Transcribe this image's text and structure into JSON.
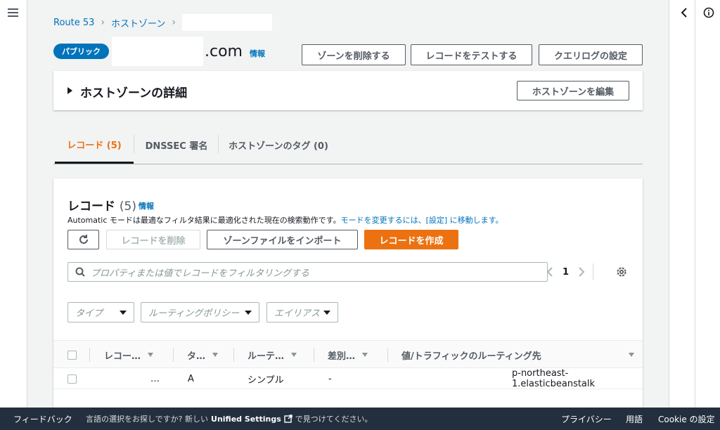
{
  "breadcrumb": {
    "root": "Route 53",
    "zones": "ホストゾーン"
  },
  "header": {
    "badge": "パブリック",
    "domain_suffix": ".com",
    "info": "情報",
    "delete_zone": "ゾーンを削除する",
    "test_record": "レコードをテストする",
    "query_log": "クエリログの設定"
  },
  "details": {
    "title": "ホストゾーンの詳細",
    "edit": "ホストゾーンを編集"
  },
  "tabs": [
    {
      "label": "レコード (5)"
    },
    {
      "label": "DNSSEC 署名"
    },
    {
      "label": "ホストゾーンのタグ (0)"
    }
  ],
  "records": {
    "title": "レコード",
    "count": "(5)",
    "info": "情報",
    "desc_prefix": "Automatic モードは最適なフィルタ結果に最適化された現在の検索動作です。",
    "desc_link": "モードを変更するには、[設定] に移動します。",
    "delete": "レコードを削除",
    "import": "ゾーンファイルをインポート",
    "create": "レコードを作成",
    "search_placeholder": "プロパティまたは値でレコードをフィルタリングする",
    "page": "1",
    "filters": {
      "type": "タイプ",
      "routing": "ルーティングポリシー",
      "alias": "エイリアス"
    },
    "columns": {
      "name": "レコー…",
      "type": "タ…",
      "routing": "ルーテ…",
      "diff": "差別…",
      "value": "値/トラフィックのルーティング先"
    },
    "row1": {
      "name": "…",
      "type": "A",
      "routing": "シンプル",
      "diff": "-",
      "value": "p-northeast-1.elasticbeanstalk"
    }
  },
  "footer": {
    "feedback": "フィードバック",
    "desc_prefix": "言語の選択をお探しですか? 新しい",
    "desc_link": "Unified Settings",
    "desc_suffix": "で見つけてください。",
    "privacy": "プライバシー",
    "terms": "用語",
    "cookie": "Cookie の設定"
  }
}
